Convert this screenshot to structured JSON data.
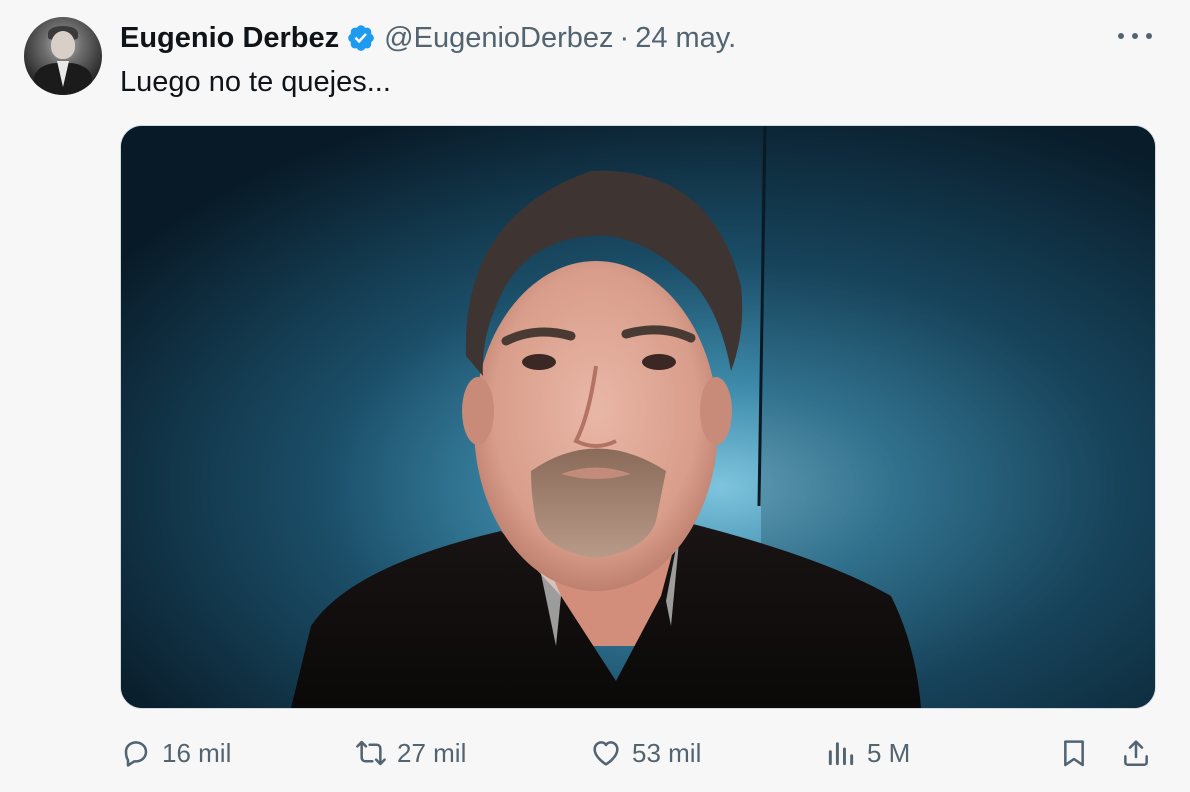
{
  "author": {
    "display_name": "Eugenio Derbez",
    "handle": "@EugenioDerbez",
    "separator": "·",
    "date": "24 may.",
    "verified": true
  },
  "tweet": {
    "text": "Luego no te quejes..."
  },
  "actions": {
    "replies": "16 mil",
    "retweets": "27 mil",
    "likes": "53 mil",
    "views": "5 M"
  },
  "colors": {
    "verified_badge": "#1d9bf0",
    "secondary_text": "#536471"
  },
  "icons": {
    "more": "more-horizontal-icon",
    "reply": "reply-icon",
    "retweet": "retweet-icon",
    "like": "heart-icon",
    "views": "views-icon",
    "bookmark": "bookmark-icon",
    "share": "share-icon"
  }
}
